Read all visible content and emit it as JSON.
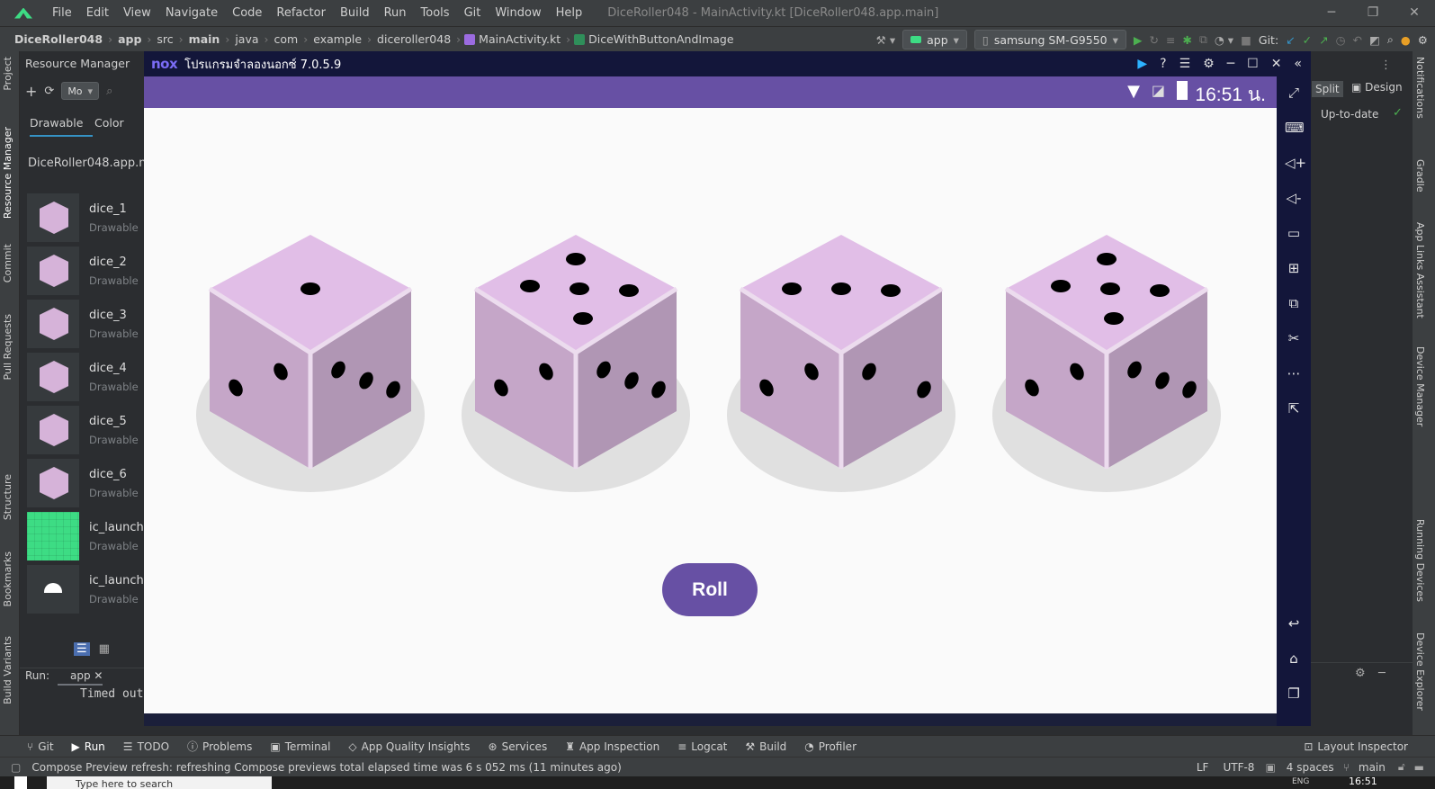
{
  "ide": {
    "menu": [
      "File",
      "Edit",
      "View",
      "Navigate",
      "Code",
      "Refactor",
      "Build",
      "Run",
      "Tools",
      "Git",
      "Window",
      "Help"
    ],
    "window_title": "DiceRoller048 - MainActivity.kt [DiceRoller048.app.main]",
    "breadcrumb": [
      "DiceRoller048",
      "app",
      "src",
      "main",
      "java",
      "com",
      "example",
      "diceroller048",
      "MainActivity.kt",
      "DiceWithButtonAndImage"
    ],
    "run_config": "app",
    "device": "samsung SM-G9550",
    "git_label": "Git:",
    "split_label": "Split",
    "design_label": "Design",
    "up_to_date": "Up-to-date"
  },
  "left_strip": [
    "Project",
    "Resource Manager",
    "Commit",
    "Pull Requests",
    "Structure",
    "Bookmarks",
    "Build Variants"
  ],
  "right_strip": [
    "Notifications",
    "Gradle",
    "App Links Assistant",
    "Device Manager",
    "Running Devices",
    "Device Explorer"
  ],
  "resource_manager": {
    "title": "Resource Manager",
    "module_select": "Mo",
    "tabs": [
      "Drawable",
      "Color"
    ],
    "module": "DiceRoller048.app.ma",
    "items": [
      {
        "name": "dice_1",
        "type": "Drawable"
      },
      {
        "name": "dice_2",
        "type": "Drawable"
      },
      {
        "name": "dice_3",
        "type": "Drawable"
      },
      {
        "name": "dice_4",
        "type": "Drawable"
      },
      {
        "name": "dice_5",
        "type": "Drawable"
      },
      {
        "name": "dice_6",
        "type": "Drawable"
      },
      {
        "name": "ic_launche",
        "type": "Drawable"
      },
      {
        "name": "ic_launche",
        "type": "Drawable"
      }
    ]
  },
  "run_panel": {
    "label": "Run:",
    "tab": "app",
    "output": "Timed out"
  },
  "nox": {
    "logo": "nox",
    "title": "โปรแกรมจำลองนอกซ์ 7.0.5.9",
    "clock": "16:51 น.",
    "roll_label": "Roll",
    "dice_faces": [
      1,
      5,
      3,
      5
    ]
  },
  "bottom_tabs": [
    "Git",
    "Run",
    "TODO",
    "Problems",
    "Terminal",
    "App Quality Insights",
    "Services",
    "App Inspection",
    "Logcat",
    "Build",
    "Profiler"
  ],
  "layout_inspector": "Layout Inspector",
  "status": {
    "message": "Compose Preview refresh: refreshing Compose previews total elapsed time was 6 s 052 ms (11 minutes ago)",
    "line_ending": "LF",
    "encoding": "UTF-8",
    "indent": "4 spaces",
    "branch": "main"
  },
  "taskbar": {
    "search": "Type here to search",
    "time": "16:51",
    "lang": "ENG"
  },
  "colors": {
    "purple": "#6750a4",
    "die_top": "#e1bee7",
    "die_left": "#c5a6c8",
    "die_right": "#b096b4"
  }
}
